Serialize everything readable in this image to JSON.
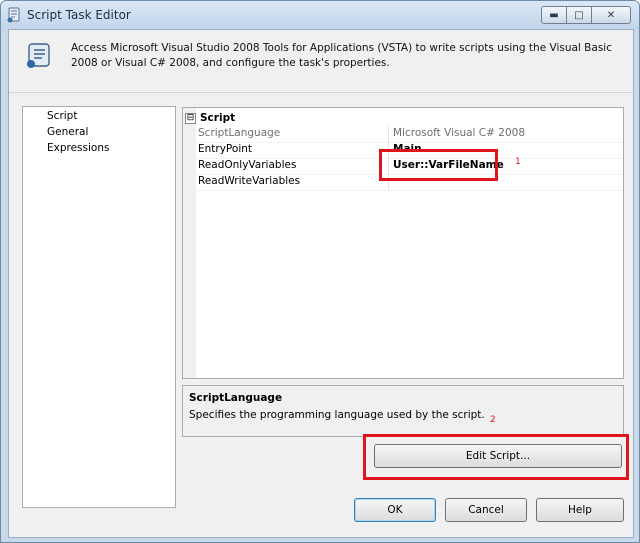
{
  "window": {
    "title": "Script Task Editor",
    "controls": {
      "minimize": "▬",
      "maximize": "□",
      "close": "✕"
    }
  },
  "header": {
    "description": "Access Microsoft Visual Studio 2008 Tools for Applications (VSTA) to write scripts using the Visual Basic 2008 or Visual C# 2008, and configure the task's properties."
  },
  "nav": {
    "items": [
      {
        "label": "Script",
        "selected": true
      },
      {
        "label": "General",
        "selected": false
      },
      {
        "label": "Expressions",
        "selected": false
      }
    ]
  },
  "property_grid": {
    "category": {
      "label": "Script",
      "expander": "⊟"
    },
    "rows": [
      {
        "name": "ScriptLanguage",
        "value": "Microsoft Visual C# 2008",
        "readonly": true
      },
      {
        "name": "EntryPoint",
        "value": "Main",
        "readonly": false
      },
      {
        "name": "ReadOnlyVariables",
        "value": "User::VarFileName",
        "readonly": false
      },
      {
        "name": "ReadWriteVariables",
        "value": "",
        "readonly": false
      }
    ]
  },
  "description_panel": {
    "title": "ScriptLanguage",
    "text": "Specifies the programming language used by the script."
  },
  "annotations": {
    "marker1": "1",
    "marker2": "2",
    "color": "#e0141e"
  },
  "buttons": {
    "edit_script": "Edit Script...",
    "ok": "OK",
    "cancel": "Cancel",
    "help": "Help"
  }
}
